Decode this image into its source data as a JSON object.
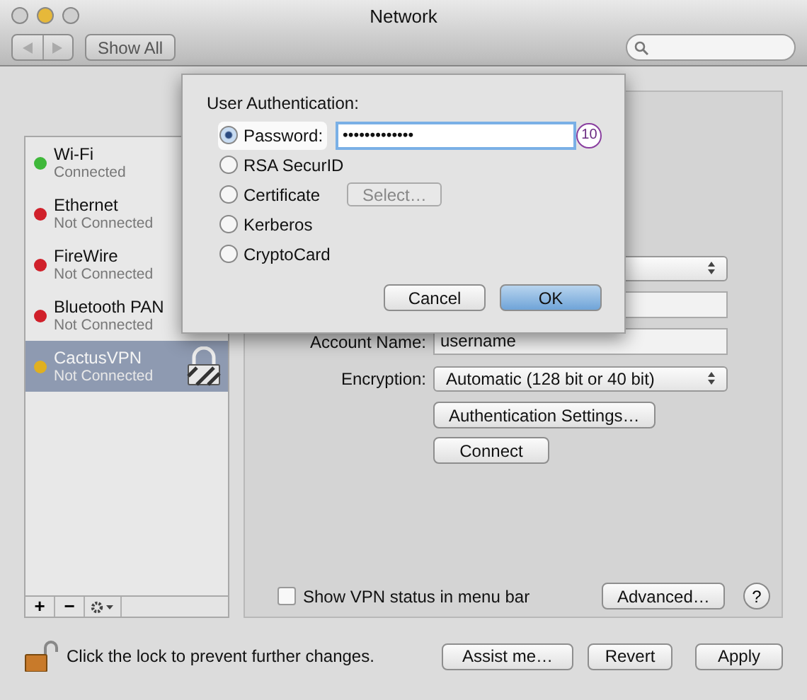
{
  "window": {
    "title": "Network"
  },
  "toolbar": {
    "show_all": "Show All"
  },
  "sidebar": {
    "services": [
      {
        "name": "Wi-Fi",
        "status": "Connected",
        "color": "#3fb83a",
        "selected": false,
        "kind": "interface"
      },
      {
        "name": "Ethernet",
        "status": "Not Connected",
        "color": "#d0202a",
        "selected": false,
        "kind": "interface"
      },
      {
        "name": "FireWire",
        "status": "Not Connected",
        "color": "#d0202a",
        "selected": false,
        "kind": "interface"
      },
      {
        "name": "Bluetooth PAN",
        "status": "Not Connected",
        "color": "#d0202a",
        "selected": false,
        "kind": "interface"
      },
      {
        "name": "CactusVPN",
        "status": "Not Connected",
        "color": "#e0b020",
        "selected": true,
        "kind": "vpn"
      }
    ],
    "add": "+",
    "remove": "−"
  },
  "vpn_form": {
    "account_name": {
      "label": "Account Name:",
      "value": "username"
    },
    "encryption": {
      "label": "Encryption:",
      "value": "Automatic (128 bit or 40 bit)"
    },
    "buttons": [
      "Authentication Settings…",
      "Connect"
    ],
    "show_status": {
      "label": "Show VPN status in menu bar",
      "checked": false
    },
    "advanced": "Advanced…",
    "help": "?"
  },
  "auth_dialog": {
    "title": "User Authentication:",
    "options": [
      {
        "label": "Password:",
        "selected": true,
        "kind": "password",
        "value": "•••••••••••••",
        "badge": "10"
      },
      {
        "label": "RSA SecurID",
        "selected": false,
        "kind": "plain"
      },
      {
        "label": "Certificate",
        "selected": false,
        "kind": "select",
        "button": "Select…",
        "disabled": true
      },
      {
        "label": "Kerberos",
        "selected": false,
        "kind": "plain"
      },
      {
        "label": "CryptoCard",
        "selected": false,
        "kind": "plain"
      }
    ],
    "buttons": [
      {
        "label": "Cancel",
        "default": false
      },
      {
        "label": "OK",
        "default": true
      }
    ]
  },
  "footer": {
    "lock_text": "Click the lock to prevent further changes.",
    "buttons": [
      "Assist me…",
      "Revert",
      "Apply"
    ]
  }
}
